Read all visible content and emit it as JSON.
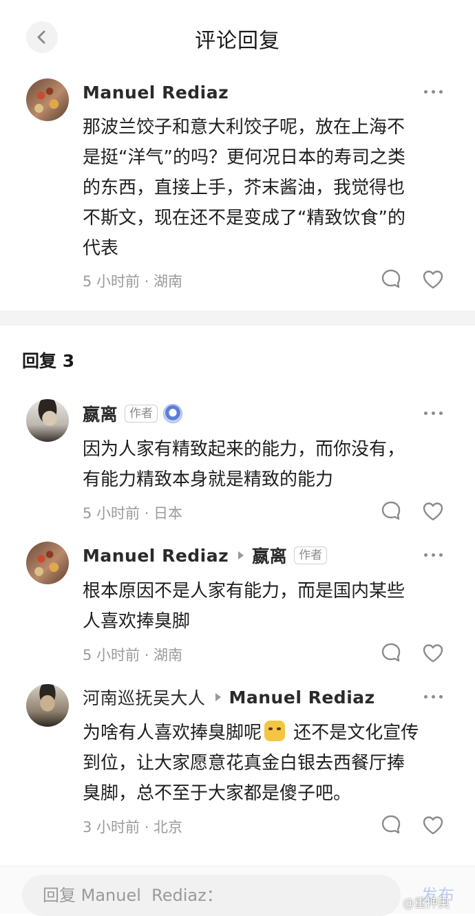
{
  "header": {
    "title": "评论回复"
  },
  "main_comment": {
    "username": "Manuel  Rediaz",
    "text": "那波兰饺子和意大利饺子呢，放在上海不\n是挺“洋气”的吗？更何况日本的寿司之类\n的东西，直接上手，芥末酱油，我觉得也\n不斯文，现在还不是变成了“精致饮食”的\n代表",
    "meta": "5 小时前 · 湖南"
  },
  "replies_heading": "回复 3",
  "replies": [
    {
      "username": "嬴离",
      "badge": "作者",
      "text": "因为人家有精致起来的能力，而你没有，\n有能力精致本身就是精致的能力",
      "meta": "5 小时前 · 日本"
    },
    {
      "username": "Manuel  Rediaz",
      "reply_to": "嬴离",
      "badge": "作者",
      "text": "根本原因不是人家有能力，而是国内某些\n人喜欢捧臭脚",
      "meta": "5 小时前 · 湖南"
    },
    {
      "username": "河南巡抚吴大人",
      "reply_to": "Manuel  Rediaz",
      "text_part1": "为啥有人喜欢捧臭脚呢",
      "text_part2": " 还不是文化宣传\n到位，让大家愿意花真金白银去西餐厅捧\n臭脚，总不至于大家都是傻子吧。",
      "meta": "3 小时前 · 北京"
    }
  ],
  "bottom_bar": {
    "placeholder": "回复 Manuel  Rediaz：",
    "send_label": "发布"
  },
  "watermark": "@重押奥",
  "icons": {
    "back": "chevron-left-icon",
    "more": "more-dots-icon",
    "comment": "comment-bubble-icon",
    "like": "heart-icon",
    "medal": "medal-icon",
    "emoji": "cat-emoji-icon"
  },
  "colors": {
    "meta_text": "#9a9a9a",
    "send_disabled": "#b9cdf0",
    "divider": "#f4f4f4"
  }
}
